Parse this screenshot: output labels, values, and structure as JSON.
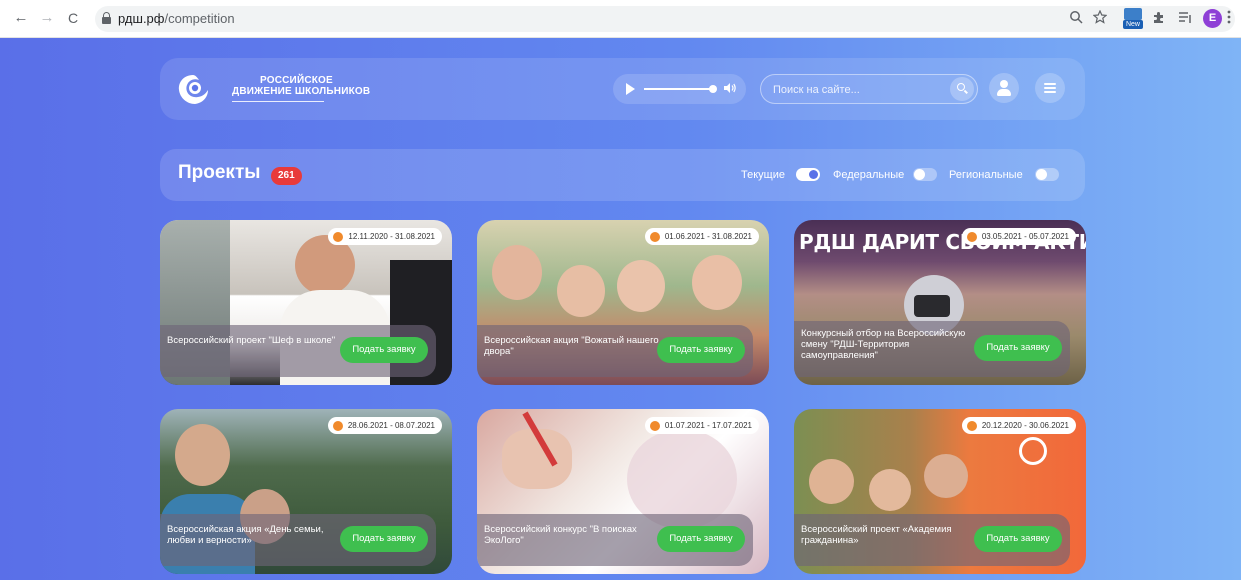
{
  "browser": {
    "url_domain": "рдш.рф",
    "url_path": "/competition",
    "back_icon": "←",
    "forward_icon": "→",
    "reload_icon": "C",
    "profile_initial": "E",
    "ext_new_label": "New"
  },
  "header": {
    "logo_line1": "РОССИЙСКОЕ",
    "logo_line2": "ДВИЖЕНИЕ ШКОЛЬНИКОВ",
    "search_placeholder": "Поиск на сайте..."
  },
  "projects": {
    "title": "Проекты",
    "count": "261",
    "filters": [
      {
        "label": "Текущие",
        "on": true
      },
      {
        "label": "Федеральные",
        "on": false
      },
      {
        "label": "Региональные",
        "on": false
      }
    ]
  },
  "cards": [
    {
      "date": "12.11.2020 - 31.08.2021",
      "title": "Всероссийский проект \"Шеф в школе\"",
      "button": "Подать заявку"
    },
    {
      "date": "01.06.2021 - 31.08.2021",
      "title": "Всероссийская акция \"Вожатый нашего двора\"",
      "button": "Подать заявку"
    },
    {
      "date": "03.05.2021 - 05.07.2021",
      "title": "Конкурсный отбор на Всероссийскую смену \"РДШ-Территория самоуправления\"",
      "button": "Подать заявку",
      "banner": "РДШ ДАРИТ СВОИМ АКТИВИСТАМ АРТЕК"
    },
    {
      "date": "28.06.2021 - 08.07.2021",
      "title": "Всероссийская акция «День семьи, любви и верности»",
      "button": "Подать заявку"
    },
    {
      "date": "01.07.2021 - 17.07.2021",
      "title": "Всероссийский конкурс \"В поисках ЭкоЛого\"",
      "button": "Подать заявку"
    },
    {
      "date": "20.12.2020 - 30.06.2021",
      "title": "Всероссийский проект «Академия гражданина»",
      "button": "Подать заявку"
    }
  ]
}
